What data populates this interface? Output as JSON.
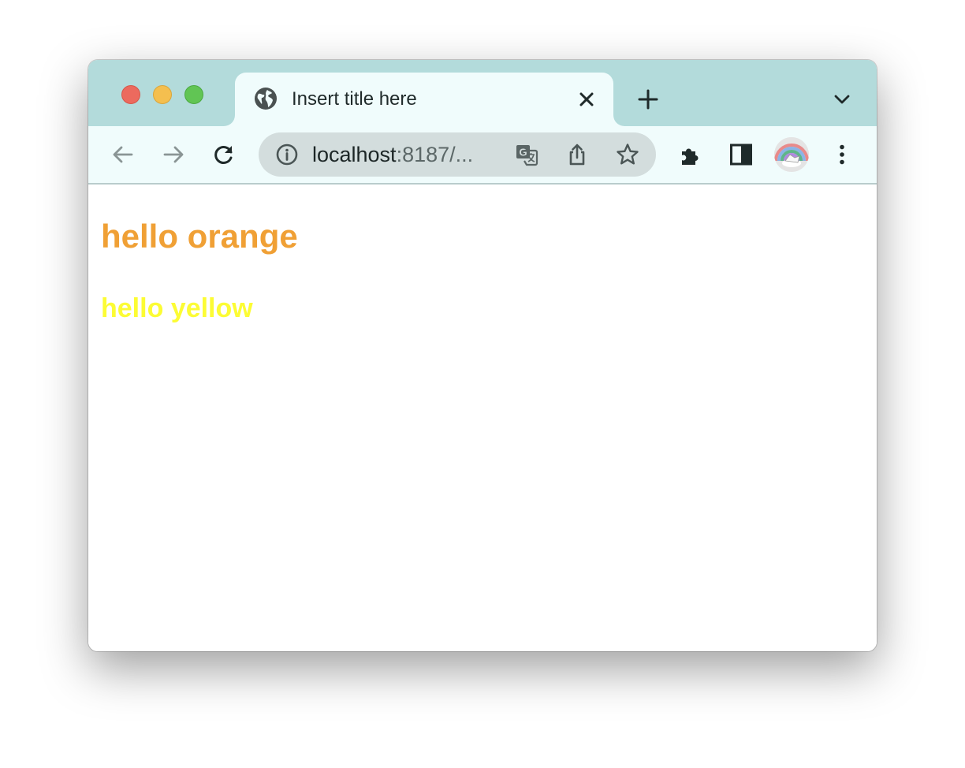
{
  "tab": {
    "title": "Insert title here",
    "favicon": "globe-icon"
  },
  "address_bar": {
    "host": "localhost",
    "path": ":8187/..."
  },
  "page": {
    "heading_orange": "hello orange",
    "heading_yellow": "hello yellow"
  },
  "colors": {
    "tabstrip": "#b3dbdb",
    "toolbar": "#f0fcfc",
    "orange_text": "#f0a035",
    "yellow_text": "#fcfc34"
  },
  "icons": {
    "nav": [
      "back-arrow-icon",
      "forward-arrow-icon",
      "reload-icon"
    ],
    "omnibox": [
      "info-icon",
      "translate-icon",
      "share-icon",
      "star-icon"
    ],
    "toolbar_right": [
      "extensions-icon",
      "side-panel-icon",
      "profile-avatar",
      "more-menu-icon"
    ]
  }
}
